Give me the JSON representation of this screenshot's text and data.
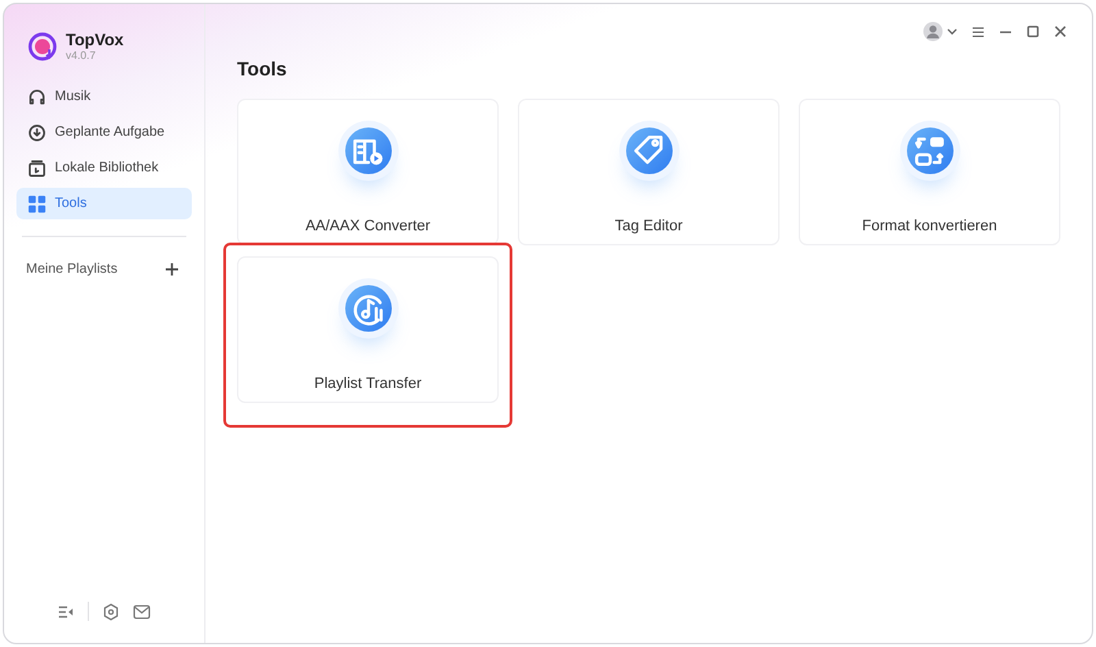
{
  "app": {
    "name": "TopVox",
    "version": "v4.0.7"
  },
  "sidebar": {
    "items": [
      {
        "label": "Musik",
        "kind": "headphones",
        "selected": false
      },
      {
        "label": "Geplante Aufgabe",
        "kind": "download",
        "selected": false
      },
      {
        "label": "Lokale Bibliothek",
        "kind": "library",
        "selected": false
      },
      {
        "label": "Tools",
        "kind": "grid",
        "selected": true
      }
    ],
    "playlists_label": "Meine Playlists"
  },
  "page_title": "Tools",
  "tools": [
    {
      "label": "AA/AAX Converter",
      "kind": "book",
      "highlighted": false
    },
    {
      "label": "Tag Editor",
      "kind": "tag",
      "highlighted": false
    },
    {
      "label": "Format konvertieren",
      "kind": "convert",
      "highlighted": false
    },
    {
      "label": "Playlist Transfer",
      "kind": "music",
      "highlighted": true
    }
  ]
}
